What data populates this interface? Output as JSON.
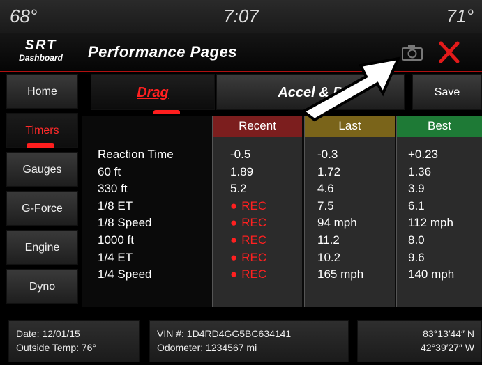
{
  "status": {
    "temp_left": "68°",
    "time": "7:07",
    "temp_right": "71°"
  },
  "header": {
    "logo_top": "SRT",
    "logo_bottom": "Dashboard",
    "title": "Performance Pages"
  },
  "sidebar": {
    "items": [
      {
        "label": "Home"
      },
      {
        "label": "Timers"
      },
      {
        "label": "Gauges"
      },
      {
        "label": "G-Force"
      },
      {
        "label": "Engine"
      },
      {
        "label": "Dyno"
      }
    ]
  },
  "tabs": {
    "drag": "Drag",
    "accel": "Accel & B",
    "save": "Save"
  },
  "table": {
    "headers": {
      "recent": "Recent",
      "last": "Last",
      "best": "Best"
    },
    "rows": [
      {
        "label": "Reaction Time",
        "recent": "-0.5",
        "last": "-0.3",
        "best": "+0.23"
      },
      {
        "label": "60 ft",
        "recent": "1.89",
        "last": "1.72",
        "best": "1.36"
      },
      {
        "label": "330 ft",
        "recent": "5.2",
        "last": "4.6",
        "best": "3.9"
      },
      {
        "label": "1/8 ET",
        "recent": "REC",
        "last": "7.5",
        "best": "6.1"
      },
      {
        "label": "1/8 Speed",
        "recent": "REC",
        "last": "94 mph",
        "best": "112 mph"
      },
      {
        "label": "1000 ft",
        "recent": "REC",
        "last": "11.2",
        "best": "8.0"
      },
      {
        "label": "1/4 ET",
        "recent": "REC",
        "last": "10.2",
        "best": "9.6"
      },
      {
        "label": "1/4 Speed",
        "recent": "REC",
        "last": "165 mph",
        "best": "140 mph"
      }
    ]
  },
  "footer": {
    "date": "Date: 12/01/15",
    "outside_temp": "Outside Temp: 76°",
    "vin": "VIN #: 1D4RD4GG5BC634141",
    "odometer": "Odometer: 1234567 mi",
    "lat": "83°13′44″ N",
    "lon": "42°39′27″ W"
  },
  "colors": {
    "accent": "#ff2020",
    "recent": "#7c1e1e",
    "last": "#7a641a",
    "best": "#1e7a36"
  }
}
